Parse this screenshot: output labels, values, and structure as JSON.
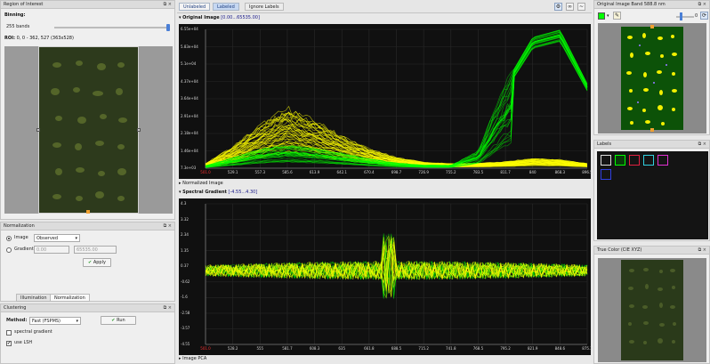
{
  "colors": {
    "accent": "#00ff00",
    "spectrum": "#ffff00",
    "window_bg": "#e8e8e8"
  },
  "roi_panel": {
    "title": "Region of Interest",
    "binning_label": "Binning:",
    "bands": "255 bands",
    "roi_label": "ROI:",
    "roi_value": "0, 0 - 362, 527 (363x528)"
  },
  "normalization_panel": {
    "title": "Normalization",
    "image_label": "Image",
    "image_mode": "Observed",
    "gradient_label": "Gradient",
    "gradient_min": "0.00",
    "gradient_max": "65535.00",
    "apply_label": "Apply",
    "tabs": [
      "Illumination",
      "Normalization"
    ]
  },
  "clustering_panel": {
    "title": "Clustering",
    "method_label": "Method:",
    "method_value": "Fast (FSPMS)",
    "run_label": "Run",
    "spectral_gradient_label": "spectral gradient",
    "use_lsh_label": "use LSH"
  },
  "toolbar": {
    "tabs": [
      "Unlabeled",
      "Labeled",
      "Ignore Labels"
    ],
    "active_tab": 1
  },
  "sections": {
    "original_image": {
      "title": "Original Image",
      "range": "[0.00...65535.00]"
    },
    "normalized_image": {
      "title": "Normalized Image"
    },
    "spectral_gradient": {
      "title": "Spectral Gradient",
      "range": "[-4.55...4.30]"
    },
    "image_pca": {
      "title": "Image PCA"
    }
  },
  "chart_data": [
    {
      "type": "line",
      "title": "Original Image [0.00...65535.00]",
      "y_ticks": [
        "6.55e+04",
        "5.83e+04",
        "5.1e+04",
        "4.37e+04",
        "3.64e+04",
        "2.91e+04",
        "2.18e+04",
        "1.46e+04",
        "7.3e+03"
      ],
      "x_ticks": [
        "501.0",
        "529.1",
        "557.3",
        "585.6",
        "613.9",
        "642.1",
        "670.4",
        "698.7",
        "726.9",
        "755.2",
        "783.5",
        "811.7",
        "840",
        "868.3",
        "896.5"
      ],
      "ylim": [
        0,
        65535
      ],
      "xlim": [
        501.0,
        896.5
      ],
      "series": [
        {
          "color": "#ffff00",
          "values": [
            2200,
            10000,
            20000,
            28000,
            22000,
            15000,
            9000,
            5000,
            2800,
            2100,
            2300,
            3000,
            4500,
            4000,
            2200
          ]
        },
        {
          "color": "#00ff00",
          "values": [
            1200,
            5000,
            9000,
            11000,
            9500,
            7000,
            4500,
            2500,
            1500,
            1400,
            8000,
            40000,
            62000,
            65535,
            40000
          ]
        }
      ]
    },
    {
      "type": "line",
      "title": "Spectral Gradient [-4.55...4.30]",
      "y_ticks": [
        "4.3",
        "3.32",
        "2.34",
        "1.35",
        "0.37",
        "-0.62",
        "-1.6",
        "-2.58",
        "-3.57",
        "-4.55"
      ],
      "x_ticks": [
        "501.0",
        "528.2",
        "555",
        "581.7",
        "608.3",
        "635",
        "661.8",
        "688.5",
        "715.2",
        "741.8",
        "768.5",
        "795.2",
        "821.9",
        "848.6",
        "875.3"
      ],
      "ylim": [
        -4.55,
        4.3
      ],
      "xlim": [
        501.0,
        896.5
      ]
    }
  ],
  "right_panels": {
    "band": {
      "title": "Original Image Band 588.8 nm",
      "slider_value": "0"
    },
    "labels": {
      "title": "Labels"
    },
    "true_color": {
      "title": "True Color (CIE XYZ)"
    }
  },
  "icons": {
    "float": "⧉",
    "close": "×",
    "check": "✔"
  }
}
